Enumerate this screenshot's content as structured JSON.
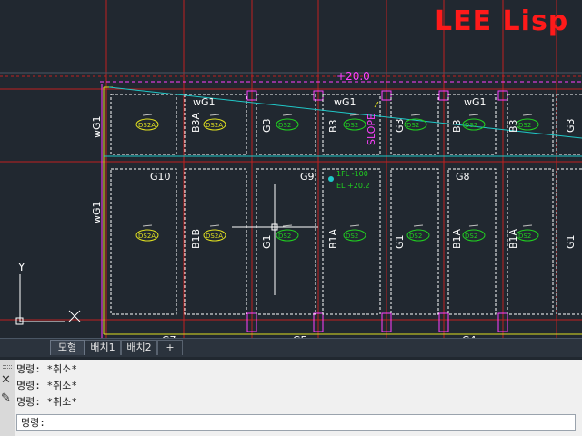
{
  "brand": {
    "text": "LEE Lisp",
    "color": "#ff1a1a"
  },
  "drawing": {
    "elevation_label": "+20.0",
    "slope_label": "SLOPE",
    "level_note_1": "1FL -100",
    "level_note_2": "EL +20.2",
    "girders": [
      "wG1",
      "wG1",
      "wG1",
      "G10",
      "G9",
      "G8",
      "wG1"
    ],
    "beams_upper": [
      "B3A",
      "G3",
      "B3",
      "G3",
      "B3",
      "G3",
      "B3",
      "G3"
    ],
    "beams_lower": [
      "B1B",
      "G1",
      "B1A",
      "G1",
      "B1A",
      "B1A",
      "G1"
    ],
    "slab_tags": [
      "DS2A",
      "DS2A",
      "DS2",
      "DS2",
      "DS2",
      "DS2",
      "DS2",
      "DS2A",
      "DS2A",
      "DS2",
      "DS2",
      "DS2",
      "DS2",
      "DS2"
    ],
    "bottom_cut_labels": [
      "G7",
      "G5",
      "G4"
    ],
    "ucs": {
      "x": "X",
      "y": "Y"
    },
    "colors": {
      "background": "#212830",
      "grid": "#cc2222",
      "dashed": "#ffffff",
      "magenta": "#ff40ff",
      "cyan": "#20c8c8",
      "yellow": "#e0e020",
      "green": "#20d020"
    }
  },
  "tabs": {
    "model": "모형",
    "layout1": "배치1",
    "layout2": "배치2",
    "add": "+"
  },
  "command": {
    "history": [
      "명령: *취소*",
      "명령: *취소*",
      "명령: *취소*"
    ],
    "prompt": "명령:"
  }
}
